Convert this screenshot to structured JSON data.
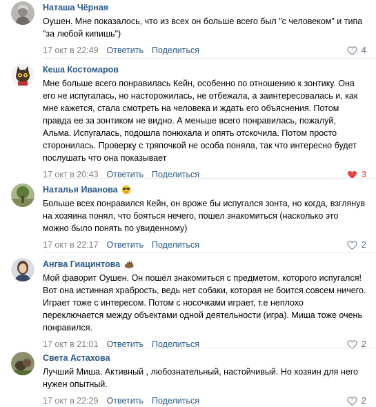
{
  "comments": [
    {
      "author": "Наташа Чёрная",
      "text": "Оушен. Мне показалось, что из всех он больше всего был \"с человеком\" и типа \"за любой кипишь\")",
      "date": "17 окт в 22:49",
      "reply_label": "Ответить",
      "share_label": "Поделиться",
      "likes": "4",
      "liked": false,
      "avatar_icon": "user-photo-icon"
    },
    {
      "author": "Кеша Костомаров",
      "text": "Мне больше всего понравилась Кейн, особенно по отношению к зонтику. Она его не испугалась, но насторожилась, не отбежала, а заинтересовалась и, как мне кажется, стала смотреть на человека и ждать его объяснения. Потом правда ее за зонтиком не видно. А меньше всего понравилась, пожалуй, Альма. Испугалась, подошла понюхала и опять отскочила. Потом просто сторонилась. Проверку с тряпочкой не особа поняла, так что интересно будет послушать что она показывает",
      "date": "17 окт в 20:43",
      "reply_label": "Ответить",
      "share_label": "Поделиться",
      "likes": "3",
      "liked": true,
      "avatar_icon": "cat-avatar-icon"
    },
    {
      "author": "Наталья Иванова",
      "emoji": "sunglasses-emoji-icon",
      "text": "Больше всех понравился Кейн, он вроже бы испугался зонта, но когда, взглянув на хозяина понял, что бояться нечего, пошел знакомиться (насколько это можно было понять по увиденному)",
      "date": "17 окт в 22:17",
      "reply_label": "Ответить",
      "share_label": "Поделиться",
      "likes": "2",
      "liked": false,
      "avatar_icon": "tree-photo-icon"
    },
    {
      "author": "Ангва Гиацинтова",
      "emoji": "hedgehog-emoji-icon",
      "text": "Мой фаворит Оушен. Он пошёл знакомиться с предметом, которого испугался! Вот она истинная храбрость, ведь нет собаки, которая не боится совсем ничего. Играет тоже с интересом. Потом с носочками играет, т.е неплохо переключается между объектами одной деятельности (игра). Миша тоже очень понравился.",
      "date": "17 окт в 21:01",
      "reply_label": "Ответить",
      "share_label": "Поделиться",
      "likes": "2",
      "liked": false,
      "avatar_icon": "woman-photo-icon"
    },
    {
      "author": "Света Астахова",
      "text": "Лучший Миша. Активный , любознательный, настойчивый. Но хозяин для него нужен опытный.",
      "date": "17 окт в 22:29",
      "reply_label": "Ответить",
      "share_label": "Поделиться",
      "likes": "2",
      "liked": false,
      "avatar_icon": "dog-photo-icon"
    }
  ],
  "colors": {
    "author": "#2a5885",
    "date": "#828282",
    "like_active": "#e64646",
    "like_inactive": "#626d7a"
  }
}
